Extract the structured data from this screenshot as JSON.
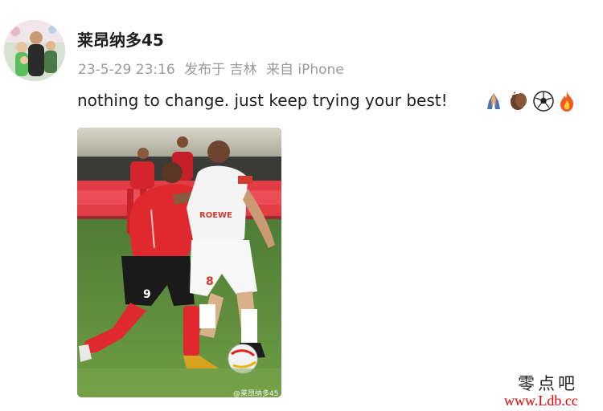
{
  "post": {
    "username": "莱昂纳多45",
    "timestamp": "23-5-29 23:16",
    "posted_in": "发布于 吉林",
    "device": "来自 iPhone",
    "text": "nothing to change. just keep trying your best!",
    "emojis": [
      "folded-hands-icon",
      "clapping-hands-icon",
      "soccer-ball-icon",
      "fire-icon"
    ],
    "photo": {
      "player_front_number": "9",
      "player_back_number": "8",
      "sponsor_text": "ROEWE",
      "watermark": "@莱昂纳多45"
    }
  },
  "site_watermark": {
    "name": "零点吧",
    "url": "www.Ldb.cc"
  }
}
